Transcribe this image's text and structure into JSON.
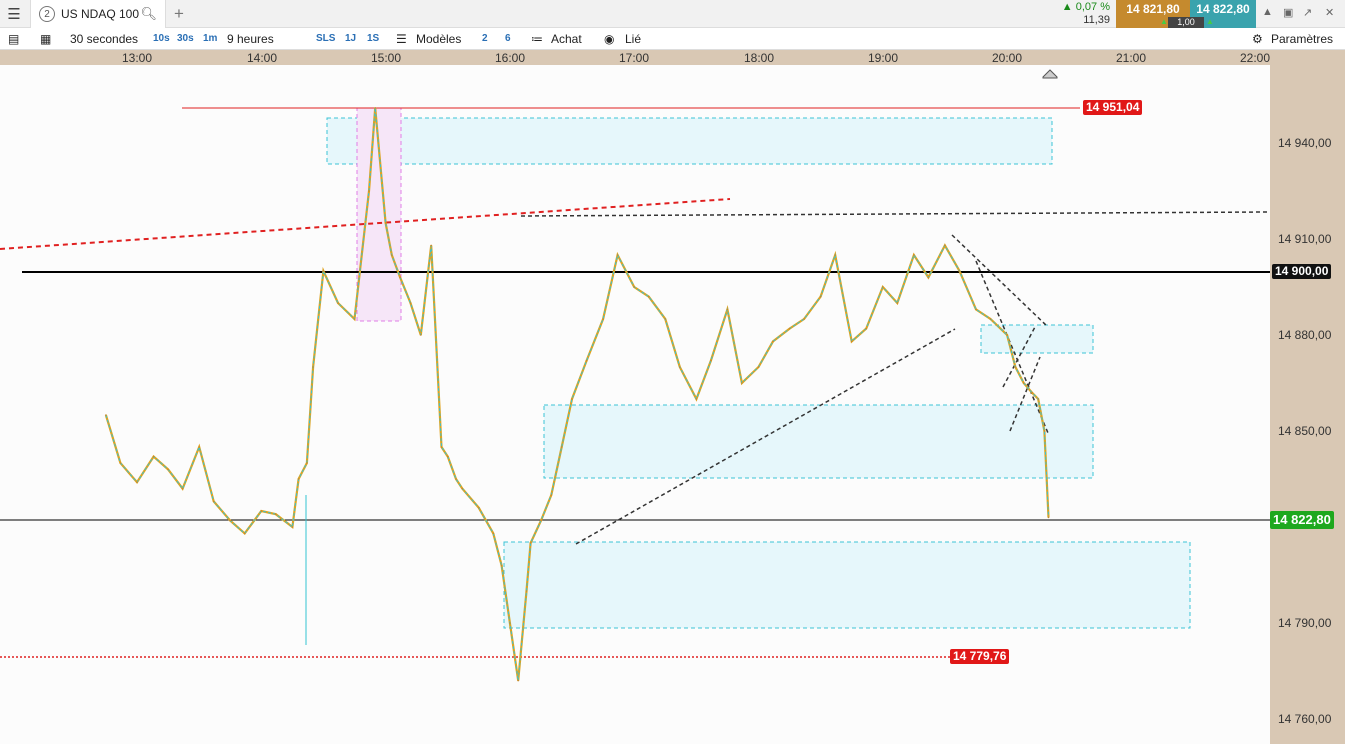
{
  "tabbar": {
    "menu_icon": "hamburger-icon",
    "tab_number": "2",
    "tab_title": "US NDAQ 100",
    "search_icon": "search-icon",
    "add_tab": "+",
    "change_pct": "0,07 %",
    "change_abs": "11,39",
    "sell_price": "14 821,80",
    "buy_price": "14 822,80",
    "spread": "1,00"
  },
  "toolbar": {
    "interval": "30 secondes",
    "btn_10s": "10s",
    "btn_30s": "30s",
    "btn_1m": "1m",
    "range": "9 heures",
    "btn_sls": "SLS",
    "btn_1j": "1J",
    "btn_1s": "1S",
    "models": "Modèles",
    "btn_2": "2",
    "btn_6": "6",
    "buy": "Achat",
    "linked": "Lié",
    "settings": "Paramètres"
  },
  "chart_data": {
    "type": "line",
    "title": "",
    "x_ticks": [
      "13:00",
      "14:00",
      "15:00",
      "16:00",
      "17:00",
      "18:00",
      "19:00",
      "20:00",
      "21:00",
      "22:00"
    ],
    "y_ticks": [
      "14 940,00",
      "14 910,00",
      "14 880,00",
      "14 850,00",
      "14 790,00",
      "14 760,00"
    ],
    "price_tags": {
      "high": "14 951,04",
      "level": "14 900,00",
      "current": "14 822,80",
      "low": "14 779,76"
    },
    "ylim": [
      14755,
      14960
    ],
    "series": [
      {
        "values_x": [
          "12:45",
          "12:52",
          "13:00",
          "13:08",
          "13:15",
          "13:22",
          "13:30",
          "13:37",
          "13:45",
          "13:52",
          "14:00",
          "14:07",
          "14:15",
          "14:18",
          "14:22",
          "14:25",
          "14:30",
          "14:37",
          "14:45",
          "14:52",
          "14:55",
          "15:00",
          "15:03",
          "15:07",
          "15:12",
          "15:17",
          "15:22",
          "15:27",
          "15:30",
          "15:34",
          "15:37",
          "15:45",
          "15:52",
          "15:56",
          "16:00",
          "16:04",
          "16:08",
          "16:10",
          "16:15",
          "16:20",
          "16:25",
          "16:30",
          "16:37",
          "16:45",
          "16:52",
          "17:00",
          "17:07",
          "17:15",
          "17:22",
          "17:30",
          "17:37",
          "17:45",
          "17:52",
          "18:00",
          "18:07",
          "18:15",
          "18:22",
          "18:30",
          "18:37",
          "18:45",
          "18:52",
          "19:00",
          "19:07",
          "19:15",
          "19:22",
          "19:30",
          "19:37",
          "19:45",
          "19:52",
          "20:00",
          "20:04",
          "20:08",
          "20:12",
          "20:15",
          "20:18",
          "20:20"
        ],
        "values": [
          14855,
          14840,
          14834,
          14842,
          14838,
          14832,
          14845,
          14828,
          14822,
          14818,
          14825,
          14824,
          14820,
          14835,
          14840,
          14870,
          14900,
          14890,
          14885,
          14925,
          14951,
          14915,
          14905,
          14898,
          14890,
          14880,
          14908,
          14845,
          14842,
          14835,
          14832,
          14826,
          14818,
          14808,
          14790,
          14772,
          14800,
          14815,
          14822,
          14830,
          14845,
          14860,
          14872,
          14885,
          14905,
          14895,
          14892,
          14885,
          14870,
          14860,
          14872,
          14888,
          14865,
          14870,
          14878,
          14882,
          14885,
          14892,
          14905,
          14878,
          14882,
          14895,
          14890,
          14905,
          14898,
          14908,
          14900,
          14888,
          14885,
          14880,
          14870,
          14865,
          14862,
          14860,
          14850,
          14823
        ]
      }
    ],
    "grid": false,
    "legend": "none"
  }
}
